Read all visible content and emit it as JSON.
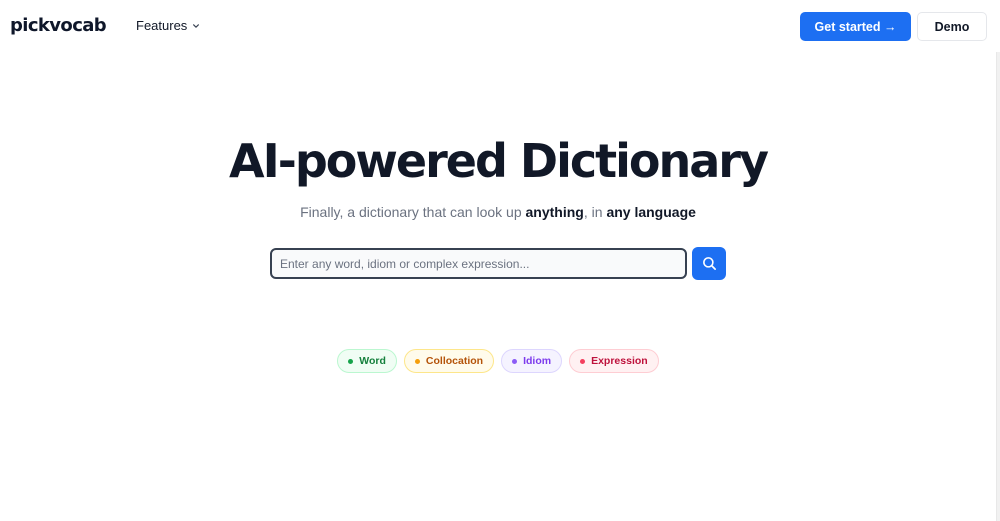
{
  "header": {
    "logo": "pickvocab",
    "features_label": "Features",
    "get_started_label": "Get started →",
    "demo_label": "Demo"
  },
  "hero": {
    "title": "AI-powered Dictionary",
    "subtitle_parts": [
      "Finally, a dictionary that can look up ",
      "anything",
      ", in ",
      "any language"
    ]
  },
  "search": {
    "value": "",
    "placeholder": "Enter any word, idiom or complex expression..."
  },
  "chips": [
    {
      "label": "Word",
      "color": "#16a34a",
      "bg": "#f0fdf4",
      "border": "#bbf7d0",
      "text": "#15803d"
    },
    {
      "label": "Collocation",
      "color": "#f59e0b",
      "bg": "#fffbeb",
      "border": "#fde68a",
      "text": "#b45309"
    },
    {
      "label": "Idiom",
      "color": "#8b5cf6",
      "bg": "#f5f3ff",
      "border": "#ddd6fe",
      "text": "#7c3aed"
    },
    {
      "label": "Expression",
      "color": "#f43f5e",
      "bg": "#fff1f2",
      "border": "#fecdd3",
      "text": "#be123c"
    }
  ],
  "colors": {
    "accent": "#1d6ff2",
    "text": "#111827",
    "muted": "#6b7280"
  },
  "icons": {
    "features_dropdown": "chevron-down-icon",
    "search_button": "search-icon"
  }
}
